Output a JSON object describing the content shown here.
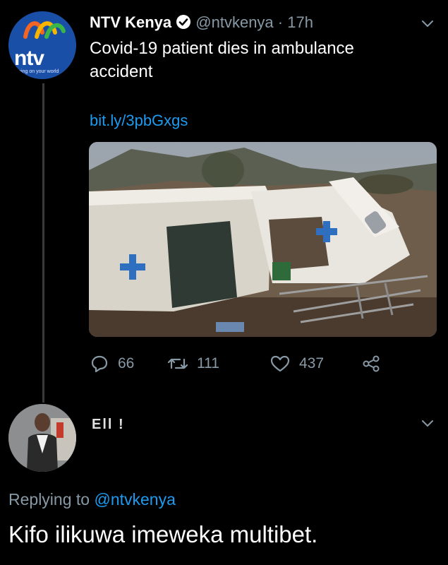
{
  "tweet": {
    "author_name": "NTV Kenya",
    "handle": "@ntvkenya",
    "separator": "·",
    "time": "17h",
    "text": "Covid-19 patient dies in ambulance accident",
    "link": "bit.ly/3pbGxgs",
    "logo_text": "ntv",
    "logo_tagline": "turning on your world",
    "stats": {
      "replies": "66",
      "retweets": "111",
      "likes": "437"
    }
  },
  "reply": {
    "author_name": "Ell !",
    "replying_prefix": "Replying to",
    "replying_mention": "@ntvkenya",
    "text": "Kifo ilikuwa imeweka multibet."
  },
  "colors": {
    "background": "#000000",
    "secondary_text": "#8899a6",
    "link": "#1d9bf0",
    "thread_line": "#3a3a3a"
  },
  "icons": [
    "verified-badge-icon",
    "chevron-down-icon",
    "reply-icon",
    "retweet-icon",
    "like-icon",
    "share-icon"
  ]
}
